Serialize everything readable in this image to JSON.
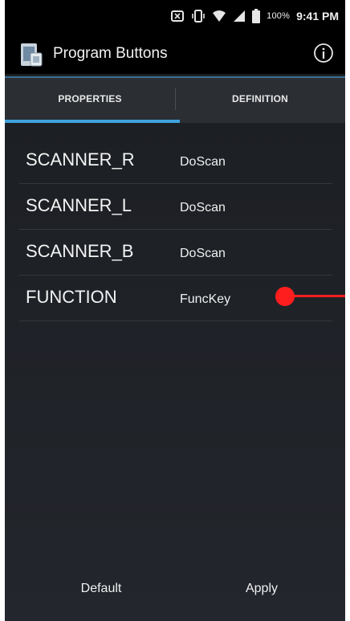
{
  "status_bar": {
    "battery": "100%",
    "time": "9:41 PM",
    "icons": [
      "nfc-icon",
      "vibrate-icon",
      "wifi-icon",
      "signal-icon",
      "battery-icon"
    ]
  },
  "app_bar": {
    "title": "Program Buttons",
    "icon": "app-icon",
    "info_icon": "info-icon"
  },
  "tabs": [
    {
      "label": "PROPERTIES",
      "selected": true
    },
    {
      "label": "DEFINITION",
      "selected": false
    }
  ],
  "buttons": [
    {
      "key": "SCANNER_R",
      "value": "DoScan"
    },
    {
      "key": "SCANNER_L",
      "value": "DoScan"
    },
    {
      "key": "SCANNER_B",
      "value": "DoScan"
    },
    {
      "key": "FUNCTION",
      "value": "FuncKey"
    }
  ],
  "footer": {
    "default_label": "Default",
    "apply_label": "Apply"
  },
  "colors": {
    "accent": "#3fa3df",
    "annotation": "#ff1e1e"
  }
}
